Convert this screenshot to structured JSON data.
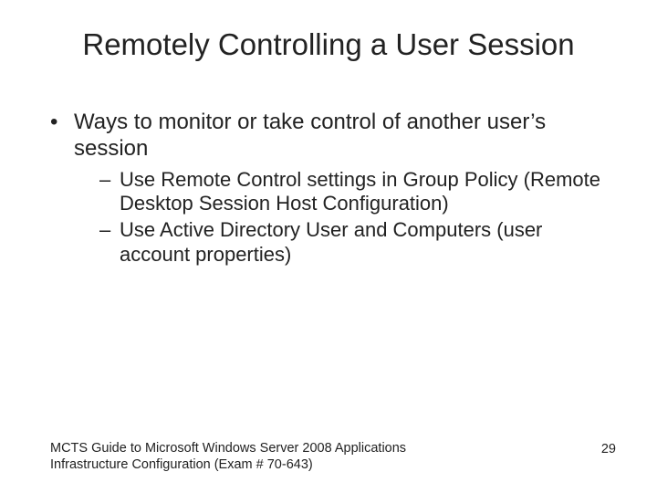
{
  "title": "Remotely Controlling a User Session",
  "bullets": [
    {
      "text": "Ways to monitor or take control of another user’s session",
      "sub": [
        "Use Remote Control settings in Group Policy (Remote Desktop Session Host Configuration)",
        "Use Active Directory User and Computers (user account properties)"
      ]
    }
  ],
  "footer": {
    "text": "MCTS Guide to Microsoft Windows Server 2008 Applications Infrastructure Configuration (Exam # 70-643)",
    "page": "29"
  }
}
